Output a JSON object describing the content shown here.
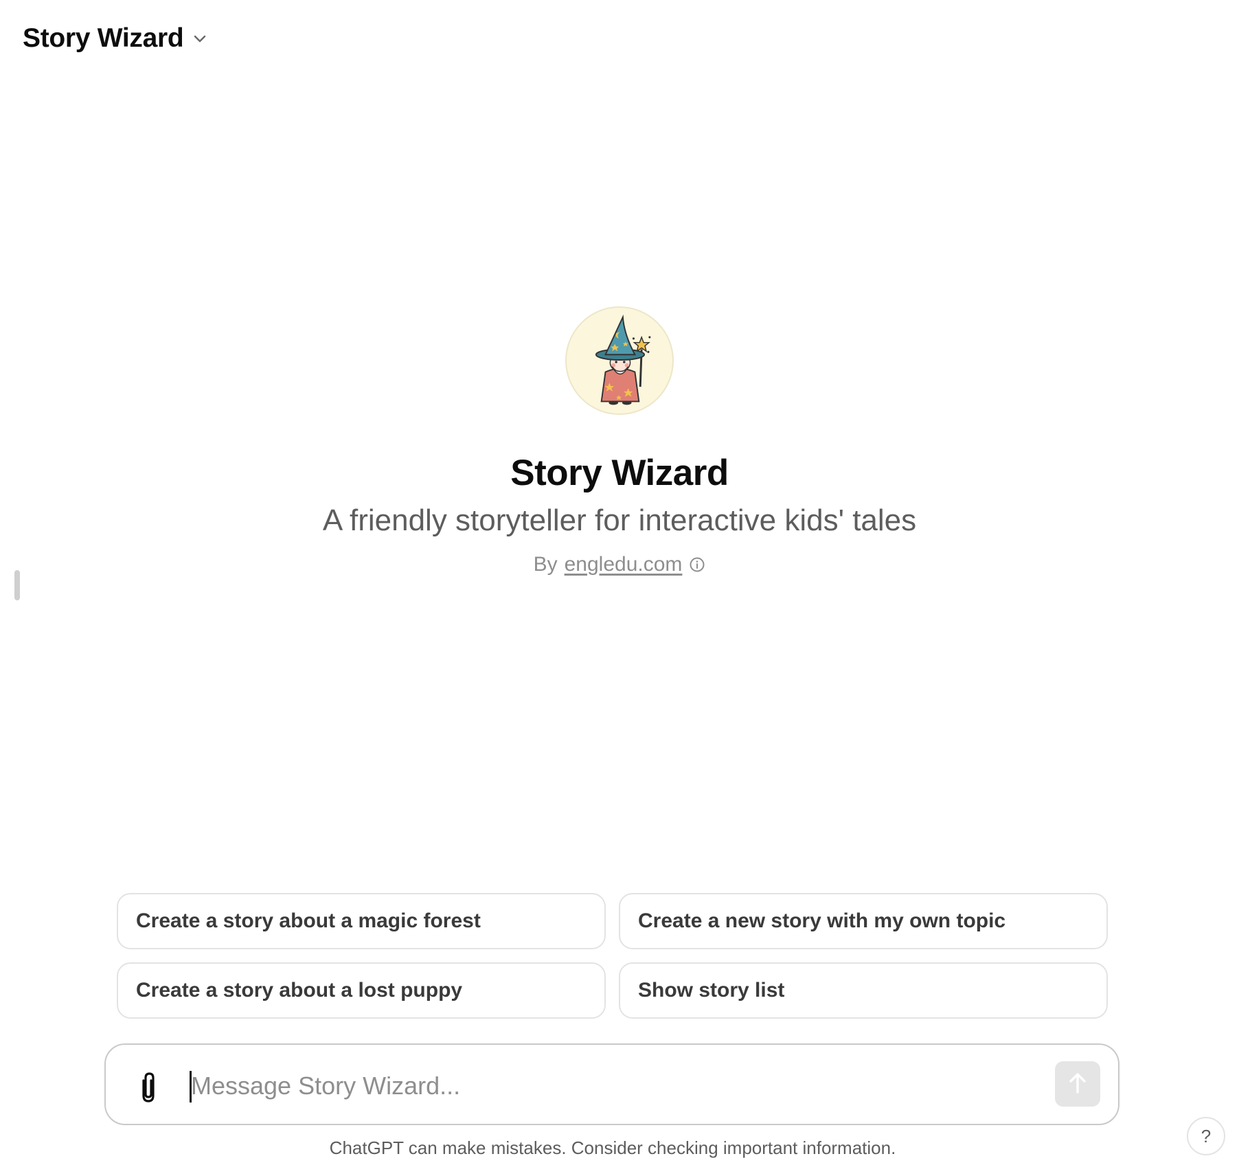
{
  "header": {
    "title": "Story Wizard",
    "dropdown_icon": "chevron-down-icon"
  },
  "gpt": {
    "avatar_icon": "wizard-avatar",
    "name": "Story Wizard",
    "description": "A friendly storyteller for interactive kids' tales",
    "by_prefix": "By",
    "author": "engledu.com",
    "info_icon": "info-icon"
  },
  "suggestions": [
    "Create a story about a magic forest",
    "Create a new story with my own topic",
    "Create a story about a lost puppy",
    "Show story list"
  ],
  "composer": {
    "placeholder": "Message Story Wizard...",
    "value": "",
    "attach_icon": "paperclip-icon",
    "send_icon": "arrow-up-icon"
  },
  "footer": {
    "disclaimer": "ChatGPT can make mistakes. Consider checking important information.",
    "help_label": "?"
  },
  "colors": {
    "text_primary": "#0d0d0d",
    "text_secondary": "#5d5d5d",
    "text_muted": "#8e8e8e",
    "border": "#e3e3e3",
    "avatar_bg": "#fbf6dc",
    "send_disabled_bg": "#e5e5e5"
  }
}
